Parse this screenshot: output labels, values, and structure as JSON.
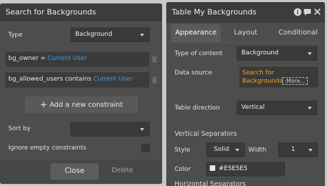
{
  "left_panel": {
    "title": "Search for Backgrounds",
    "type_label": "Type",
    "type_value": "Background",
    "constraints": [
      {
        "field": "bg_owner =",
        "value": "Current User"
      },
      {
        "field": "bg_allowed_users contains",
        "value": "Current User"
      }
    ],
    "add_constraint_icon": "plus-icon",
    "add_constraint_label": "Add a new constraint",
    "sort_by_label": "Sort by",
    "sort_by_value": "",
    "ignore_empty_label": "Ignore empty constraints",
    "ignore_empty_checked": false,
    "close_label": "Close",
    "delete_label": "Delete"
  },
  "right_panel": {
    "title": "Table My Backgrounds",
    "header_icons": [
      "info-icon",
      "comment-icon",
      "close-icon"
    ],
    "tabs": [
      {
        "label": "Appearance",
        "active": true
      },
      {
        "label": "Layout",
        "active": false
      },
      {
        "label": "Conditional",
        "active": false
      }
    ],
    "type_of_content_label": "Type of content",
    "type_of_content_value": "Background",
    "data_source_label": "Data source",
    "data_source_line1": "Search for",
    "data_source_line2": "Backgrounds",
    "data_source_more": ":More...",
    "table_direction_label": "Table direction",
    "table_direction_value": "Vertical",
    "vertical_separators_header": "Vertical Separators",
    "style_label": "Style",
    "style_value": "Solid",
    "width_label": "Width",
    "width_value": "1",
    "color_label": "Color",
    "color_value": "#E5E5E5",
    "horizontal_separators_header": "Horizontal Separators"
  },
  "colors": {
    "dynamic_text": "#3f9ee8",
    "data_source_text": "#f0a429",
    "panel_bg": "#4d4d4d",
    "title_bar_bg": "#3c3c3c"
  }
}
